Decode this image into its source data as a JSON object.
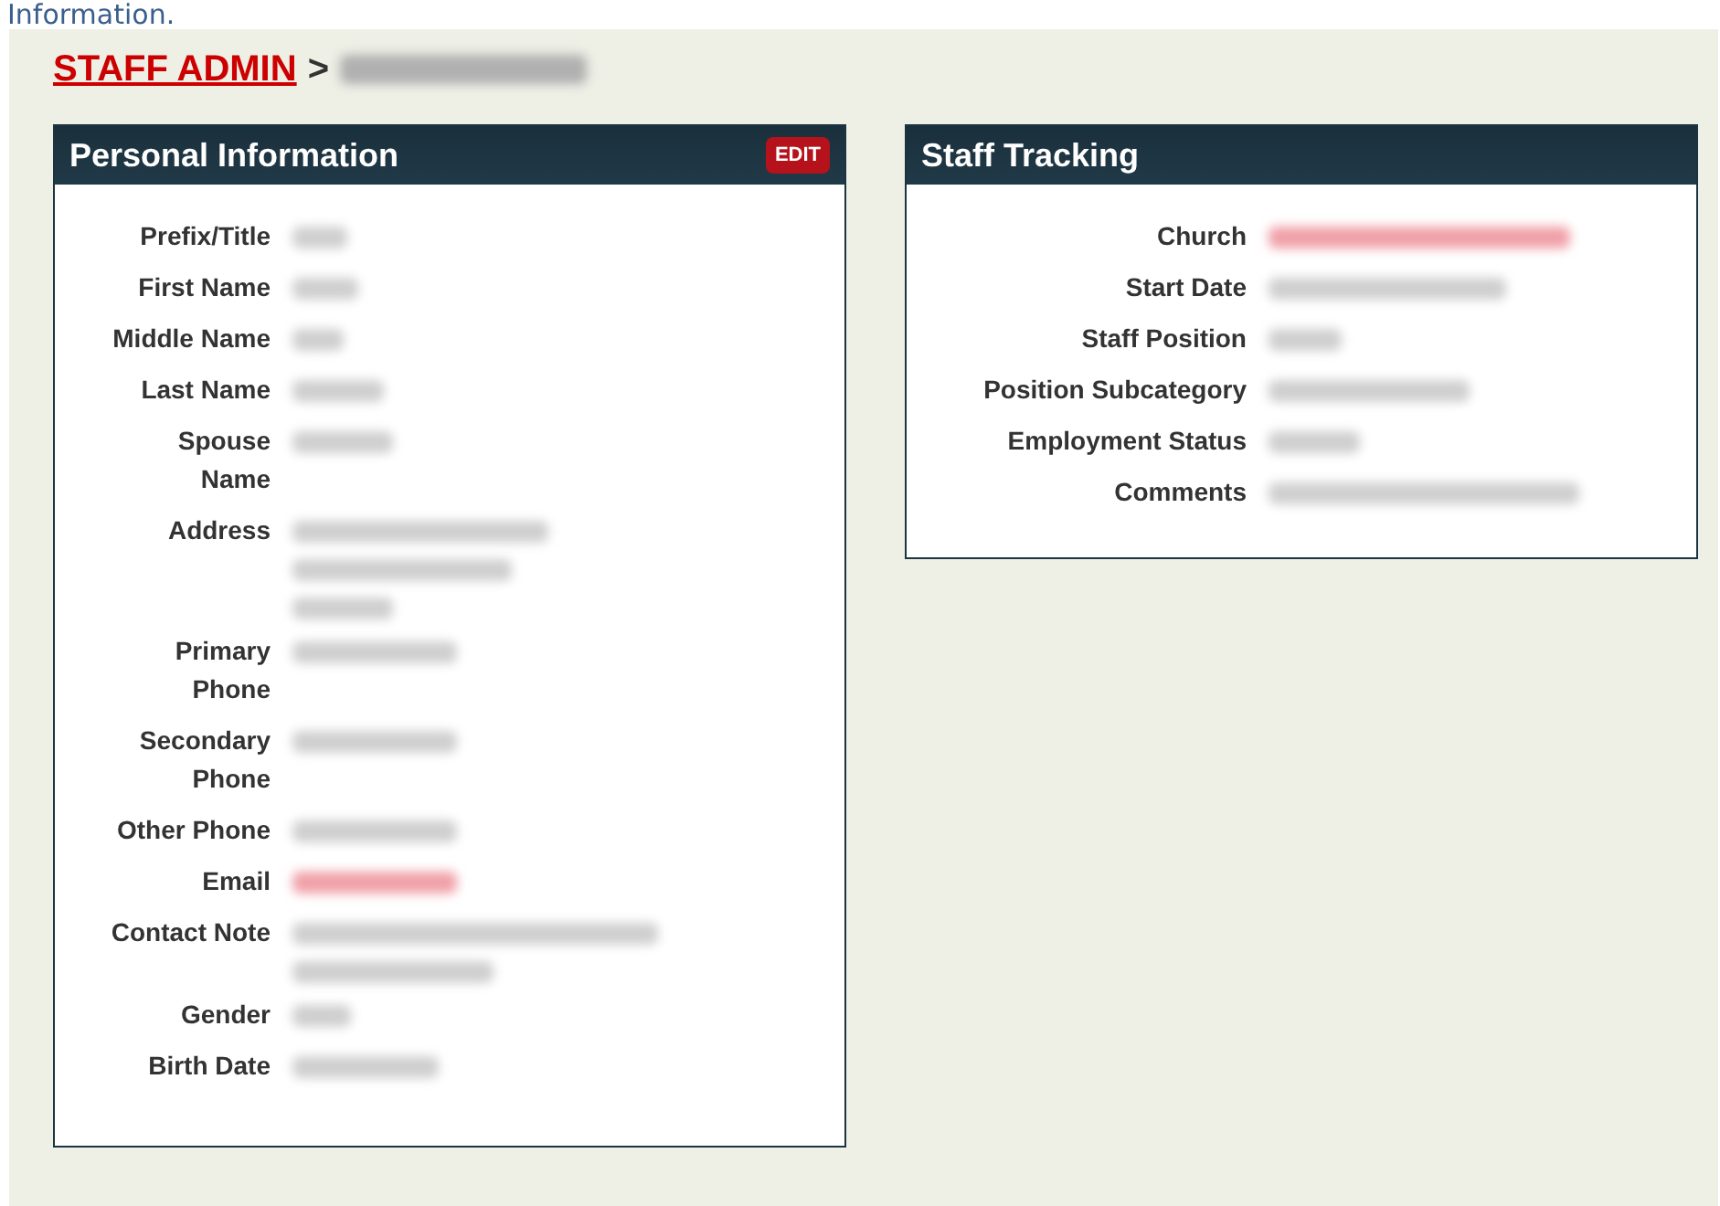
{
  "page_heading": "Information.",
  "breadcrumb": {
    "link": "STAFF ADMIN",
    "separator": ">",
    "current_blurred": true
  },
  "panels": [
    {
      "title": "Personal Information",
      "edit_button": "EDIT",
      "fields": [
        {
          "label": "Prefix/Title",
          "link": false,
          "value_lines": [
            {
              "blurred": true
            }
          ]
        },
        {
          "label": "First Name",
          "link": false,
          "value_lines": [
            {
              "blurred": true
            }
          ]
        },
        {
          "label": "Middle Name",
          "link": false,
          "value_lines": [
            {
              "blurred": true
            }
          ]
        },
        {
          "label": "Last Name",
          "link": false,
          "value_lines": [
            {
              "blurred": true
            }
          ]
        },
        {
          "label": "Spouse Name",
          "link": false,
          "value_lines": [
            {
              "blurred": true
            }
          ]
        },
        {
          "label": "Address",
          "link": false,
          "value_lines": [
            {
              "blurred": true
            },
            {
              "blurred": true
            },
            {
              "blurred": true
            }
          ]
        },
        {
          "label": "Primary Phone",
          "link": false,
          "value_lines": [
            {
              "blurred": true
            }
          ]
        },
        {
          "label": "Secondary Phone",
          "link": false,
          "value_lines": [
            {
              "blurred": true
            }
          ]
        },
        {
          "label": "Other Phone",
          "link": false,
          "value_lines": [
            {
              "blurred": true
            }
          ]
        },
        {
          "label": "Email",
          "link": true,
          "value_lines": [
            {
              "blurred": true
            }
          ]
        },
        {
          "label": "Contact Note",
          "link": false,
          "value_lines": [
            {
              "blurred": true
            },
            {
              "blurred": true
            }
          ]
        },
        {
          "label": "Gender",
          "link": false,
          "value_lines": [
            {
              "blurred": true
            }
          ]
        },
        {
          "label": "Birth Date",
          "link": false,
          "value_lines": [
            {
              "blurred": true
            }
          ]
        }
      ]
    },
    {
      "title": "Staff Tracking",
      "fields": [
        {
          "label": "Church",
          "link": true,
          "value_lines": [
            {
              "blurred": true
            }
          ]
        },
        {
          "label": "Start Date",
          "link": false,
          "value_lines": [
            {
              "blurred": true
            }
          ]
        },
        {
          "label": "Staff Position",
          "link": false,
          "value_lines": [
            {
              "blurred": true
            }
          ]
        },
        {
          "label": "Position Subcategory",
          "link": false,
          "value_lines": [
            {
              "blurred": true
            }
          ]
        },
        {
          "label": "Employment Status",
          "link": false,
          "value_lines": [
            {
              "blurred": true
            }
          ]
        },
        {
          "label": "Comments",
          "link": false,
          "value_lines": [
            {
              "blurred": true
            }
          ]
        }
      ]
    }
  ]
}
